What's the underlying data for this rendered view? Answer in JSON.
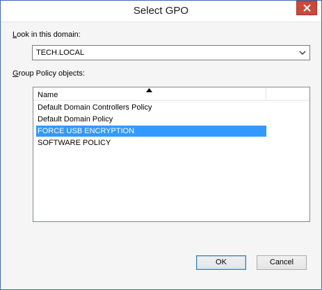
{
  "window": {
    "title": "Select GPO",
    "close_icon": "close-icon"
  },
  "domain": {
    "label_accel": "L",
    "label_rest": "ook in this domain:",
    "value": "TECH.LOCAL"
  },
  "gpo": {
    "label_accel": "G",
    "label_rest": "roup Policy objects:",
    "column_header": "Name",
    "sort": "ascending",
    "items": [
      {
        "name": "Default Domain Controllers Policy",
        "selected": false
      },
      {
        "name": "Default Domain Policy",
        "selected": false
      },
      {
        "name": "FORCE USB ENCRYPTION",
        "selected": true
      },
      {
        "name": "SOFTWARE POLICY",
        "selected": false
      }
    ]
  },
  "buttons": {
    "ok": "OK",
    "cancel": "Cancel"
  },
  "colors": {
    "selection": "#3399ff",
    "close_button": "#c9483c",
    "window_border": "#3d6bb0"
  }
}
